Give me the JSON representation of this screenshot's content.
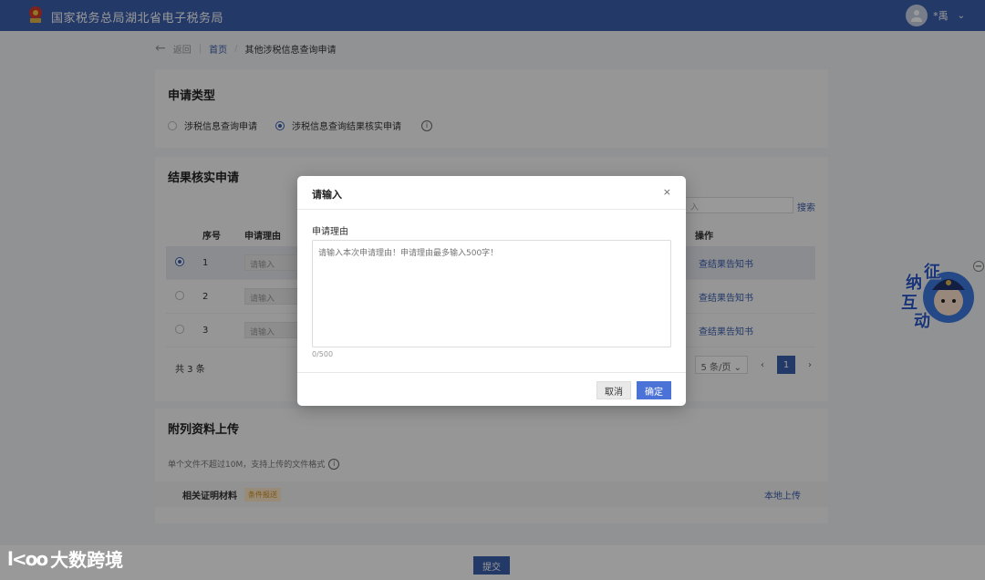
{
  "header": {
    "site_title": "国家税务总局湖北省电子税务局",
    "user_name": "*禹",
    "colors": {
      "brand": "#3b5fae"
    }
  },
  "breadcrumb": {
    "back_label": "返回",
    "home_label": "首页",
    "current_label": "其他涉税信息查询申请"
  },
  "apply_type": {
    "title": "申请类型",
    "options": [
      {
        "label": "涉税信息查询申请",
        "checked": false
      },
      {
        "label": "涉税信息查询结果核实申请",
        "checked": true
      }
    ]
  },
  "verify": {
    "title": "结果核实申请",
    "search_placeholder": "入",
    "search_label": "搜索",
    "columns": {
      "no": "序号",
      "reason": "申请理由",
      "op": "操作"
    },
    "rows": [
      {
        "no": "1",
        "reason_placeholder": "请输入",
        "op": "查结果告知书",
        "selected": true
      },
      {
        "no": "2",
        "reason_placeholder": "请输入",
        "op": "查结果告知书",
        "selected": false
      },
      {
        "no": "3",
        "reason_placeholder": "请输入",
        "op": "查结果告知书",
        "selected": false
      }
    ],
    "total": "共 3 条",
    "page_size": "5 条/页",
    "current_page": "1"
  },
  "attachments": {
    "title": "附列资料上传",
    "hint": "单个文件不超过10M，支持上传的文件格式",
    "row_label": "相关证明材料",
    "required_tag": "条件报送",
    "upload_label": "本地上传"
  },
  "submit_label": "提交",
  "mascot": {
    "chars": [
      "征",
      "纳",
      "互",
      "动"
    ]
  },
  "watermark": {
    "logo": "l<oo",
    "text": "大数跨境"
  },
  "modal": {
    "title": "请输入",
    "field_label": "申请理由",
    "placeholder": "请输入本次申请理由！申请理由最多输入500字！",
    "count": "0/500",
    "cancel_label": "取消",
    "ok_label": "确定"
  }
}
